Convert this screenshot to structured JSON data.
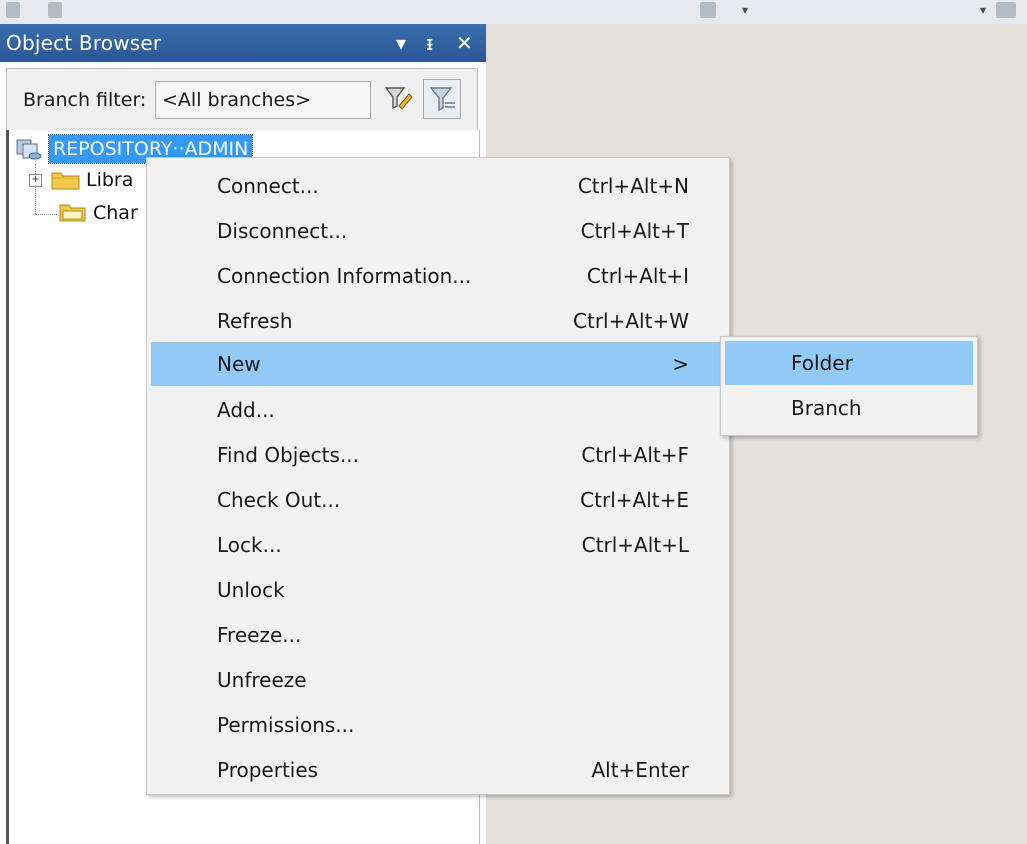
{
  "toolbar": {
    "icons": [
      "toolbar-icon",
      "toolbar-icon",
      "toolbar-icon",
      "toolbar-icon"
    ]
  },
  "panel": {
    "title": "Object Browser",
    "controls": {
      "dropdown": "▾",
      "pin": "ᵻ",
      "close": "✕"
    }
  },
  "filter": {
    "label": "Branch filter:",
    "value": "<All branches>"
  },
  "tree": {
    "root": {
      "label": "REPOSITORY··ADMIN",
      "icon": "repository-icon"
    },
    "children": [
      {
        "label": "Libra",
        "icon": "folder-icon",
        "expandable": true
      },
      {
        "label": "Char",
        "icon": "folder-open-icon",
        "expandable": false
      }
    ]
  },
  "context_menu": {
    "items": [
      {
        "label": "Connect...",
        "shortcut": "Ctrl+Alt+N"
      },
      {
        "label": "Disconnect...",
        "shortcut": "Ctrl+Alt+T"
      },
      {
        "label": "Connection Information...",
        "shortcut": "Ctrl+Alt+I"
      },
      {
        "label": "Refresh",
        "shortcut": "Ctrl+Alt+W"
      },
      {
        "label": "New",
        "shortcut": ">",
        "highlighted": true
      },
      {
        "label": "Add...",
        "shortcut": ""
      },
      {
        "label": "Find Objects...",
        "shortcut": "Ctrl+Alt+F"
      },
      {
        "label": "Check Out...",
        "shortcut": "Ctrl+Alt+E"
      },
      {
        "label": "Lock...",
        "shortcut": "Ctrl+Alt+L"
      },
      {
        "label": "Unlock",
        "shortcut": ""
      },
      {
        "label": "Freeze...",
        "shortcut": ""
      },
      {
        "label": "Unfreeze",
        "shortcut": ""
      },
      {
        "label": "Permissions...",
        "shortcut": ""
      },
      {
        "label": "Properties",
        "shortcut": "Alt+Enter"
      }
    ]
  },
  "submenu": {
    "items": [
      {
        "label": "Folder",
        "highlighted": true
      },
      {
        "label": "Branch"
      }
    ]
  },
  "colors": {
    "title_bar": "#2f5f9e",
    "selection": "#3399ff",
    "menu_highlight": "#91c9f7",
    "menu_bg": "#f2f2f2",
    "right_bg": "#e3e0db"
  }
}
